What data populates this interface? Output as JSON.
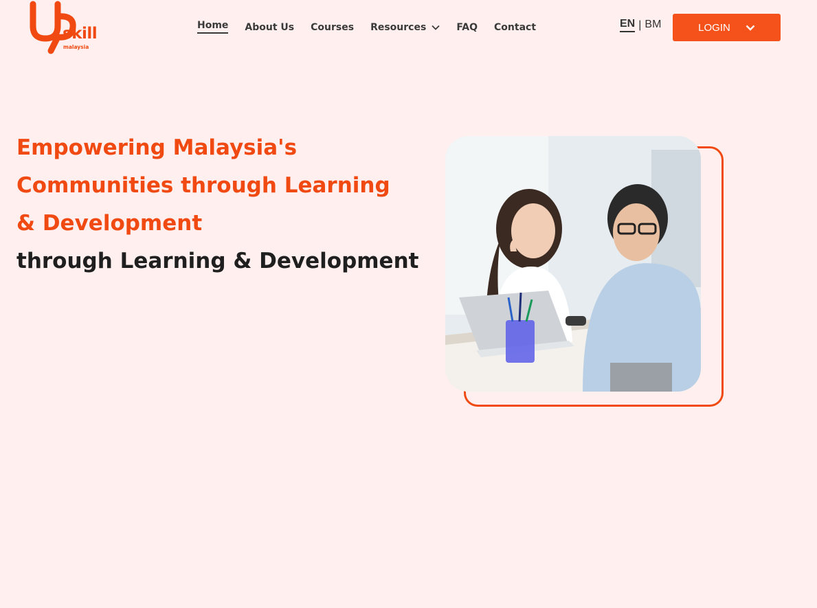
{
  "brand": {
    "logo_word": "skill",
    "logo_sub": "malaysia"
  },
  "nav": {
    "items": [
      {
        "label": "Home",
        "active": true
      },
      {
        "label": "About Us"
      },
      {
        "label": "Courses"
      },
      {
        "label": "Resources",
        "has_dropdown": true
      },
      {
        "label": "FAQ"
      },
      {
        "label": "Contact"
      }
    ]
  },
  "language": {
    "en": "EN",
    "separator": "|",
    "bm": "BM",
    "selected": "EN"
  },
  "login": {
    "label": "LOGIN",
    "icon": "chevron-down-icon"
  },
  "hero": {
    "title": "Empowering Malaysia's Communities through Learning & Development",
    "subtitle": "through Learning & Development",
    "image_icon": "photo-two-professionals-laptop"
  },
  "colors": {
    "accent": "#F04A12",
    "button": "#F5521B",
    "background": "#FFEFEE",
    "text_dark": "#1f1f1f"
  }
}
